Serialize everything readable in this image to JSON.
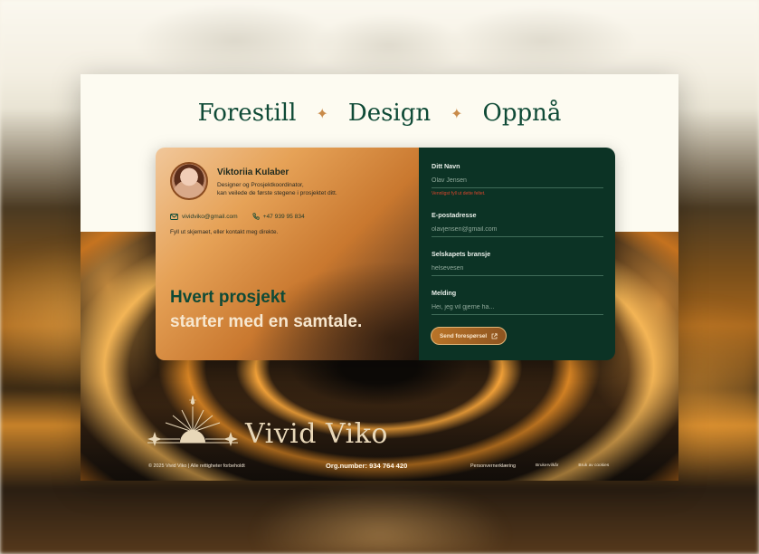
{
  "tagline": {
    "word1": "Forestill",
    "word2": "Design",
    "word3": "Oppnå",
    "separator": "✦"
  },
  "profile": {
    "name": "Viktoriia Kulaber",
    "role": "Designer og Prosjektkoordinator,\nkan veilede de første stegene i prosjektet ditt.",
    "email": "vividviko@gmail.com",
    "phone": "+47 939 95 834",
    "hint": "Fyll ut skjemaet, eller kontakt meg direkte."
  },
  "headline": {
    "line1": "Hvert prosjekt",
    "line2": "starter med en samtale."
  },
  "form": {
    "name_label": "Ditt Navn",
    "name_placeholder": "Olav Jensen",
    "name_error": "Vennligst fyll ut dette feltet.",
    "email_label": "E-postadresse",
    "email_placeholder": "olavjensen@gmail.com",
    "industry_label": "Selskapets bransje",
    "industry_placeholder": "helsevesen",
    "message_label": "Melding",
    "message_placeholder": "Hei, jeg vil gjerne ha...",
    "submit_label": "Send forespørsel"
  },
  "brand": {
    "logo_text": "Vivid Viko"
  },
  "footer": {
    "copyright": "© 2025 Vivid Viko | Alle rettigheter forbeholdt",
    "org_number": "Org.number: 934 764 420",
    "privacy": "Personvernerklæring",
    "terms": "Brukervilkår",
    "cookies": "Bruk av cookies"
  },
  "colors": {
    "accent_green": "#0f4a36",
    "form_bg": "#0c3325",
    "button_gold": "#b97428",
    "error_red": "#d8452b"
  },
  "icons": {
    "email": "mail-icon",
    "phone": "phone-icon",
    "submit": "external-link-icon",
    "logo": "sunrise-logo-icon"
  }
}
